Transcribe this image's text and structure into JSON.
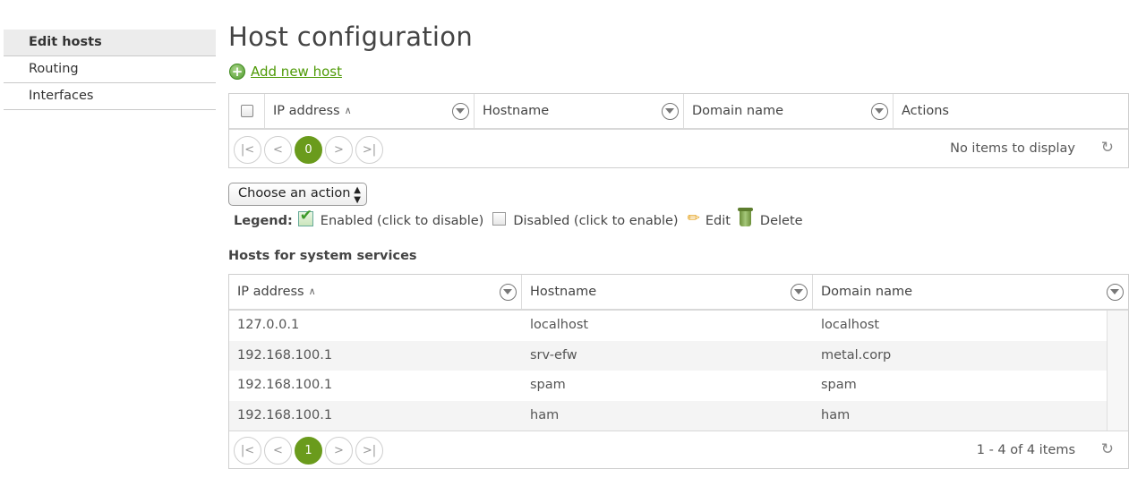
{
  "sidebar": {
    "items": [
      {
        "label": "Edit hosts"
      },
      {
        "label": "Routing"
      },
      {
        "label": "Interfaces"
      }
    ]
  },
  "page": {
    "title": "Host configuration",
    "add_link": "Add new host"
  },
  "hosts_grid": {
    "columns": [
      "IP address",
      "Hostname",
      "Domain name",
      "Actions"
    ],
    "current_page": "0",
    "status": "No items to display"
  },
  "action_select": {
    "selected": "Choose an action"
  },
  "legend": {
    "label": "Legend:",
    "enabled": "Enabled (click to disable)",
    "disabled": "Disabled (click to enable)",
    "edit": "Edit",
    "delete": "Delete"
  },
  "system_hosts": {
    "title": "Hosts for system services",
    "columns": [
      "IP address",
      "Hostname",
      "Domain name"
    ],
    "rows": [
      {
        "ip": "127.0.0.1",
        "hostname": "localhost",
        "domain": "localhost"
      },
      {
        "ip": "192.168.100.1",
        "hostname": "srv-efw",
        "domain": "metal.corp"
      },
      {
        "ip": "192.168.100.1",
        "hostname": "spam",
        "domain": "spam"
      },
      {
        "ip": "192.168.100.1",
        "hostname": "ham",
        "domain": "ham"
      }
    ],
    "current_page": "1",
    "status": "1 - 4 of 4 items"
  },
  "pager_glyphs": {
    "first": "|<",
    "prev": "<",
    "next": ">",
    "last": ">|",
    "refresh": "↻",
    "sort": "∧"
  },
  "colors": {
    "accent": "#6a9b1c",
    "link": "#4e9a06"
  }
}
